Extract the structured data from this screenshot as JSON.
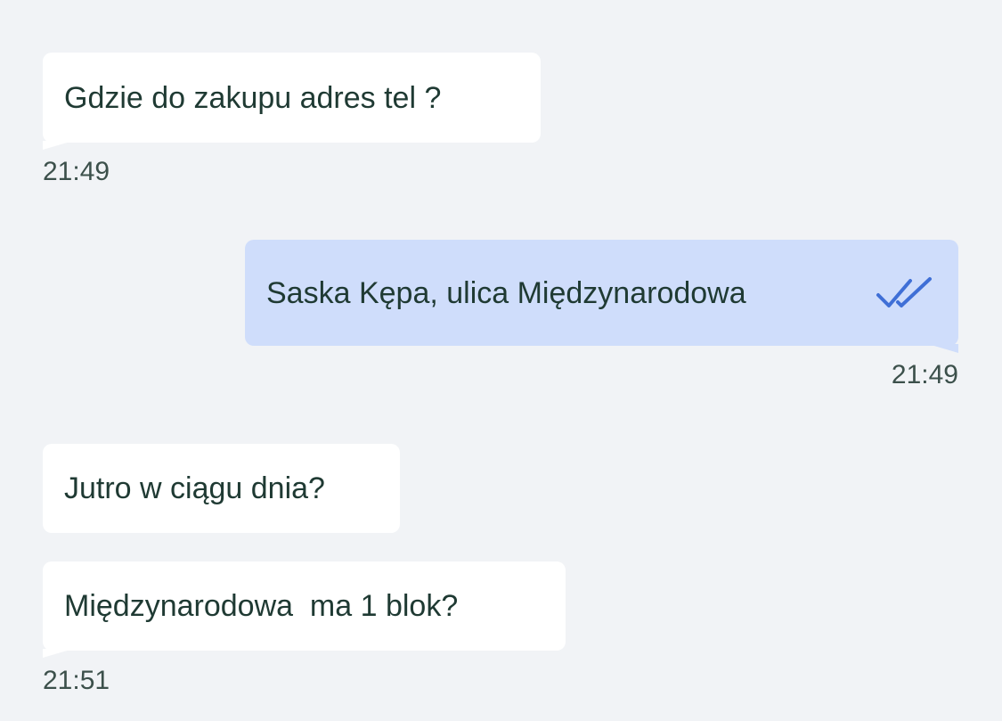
{
  "chat": {
    "messages": [
      {
        "direction": "incoming",
        "text": "Gdzie do zakupu adres tel ?",
        "time": "21:49"
      },
      {
        "direction": "outgoing",
        "text": "Saska Kępa, ulica Międzynarodowa",
        "time": "21:49",
        "status_icon": "double-check-icon"
      },
      {
        "direction": "incoming",
        "text": "Jutro w ciągu dnia?"
      },
      {
        "direction": "incoming",
        "text": "Międzynarodowa  ma 1 blok?",
        "time": "21:51"
      }
    ]
  },
  "colors": {
    "background": "#f1f3f6",
    "incoming_bubble": "#ffffff",
    "outgoing_bubble": "#cfddfb",
    "check_icon": "#3f6fd6",
    "text": "#1f3a33"
  }
}
